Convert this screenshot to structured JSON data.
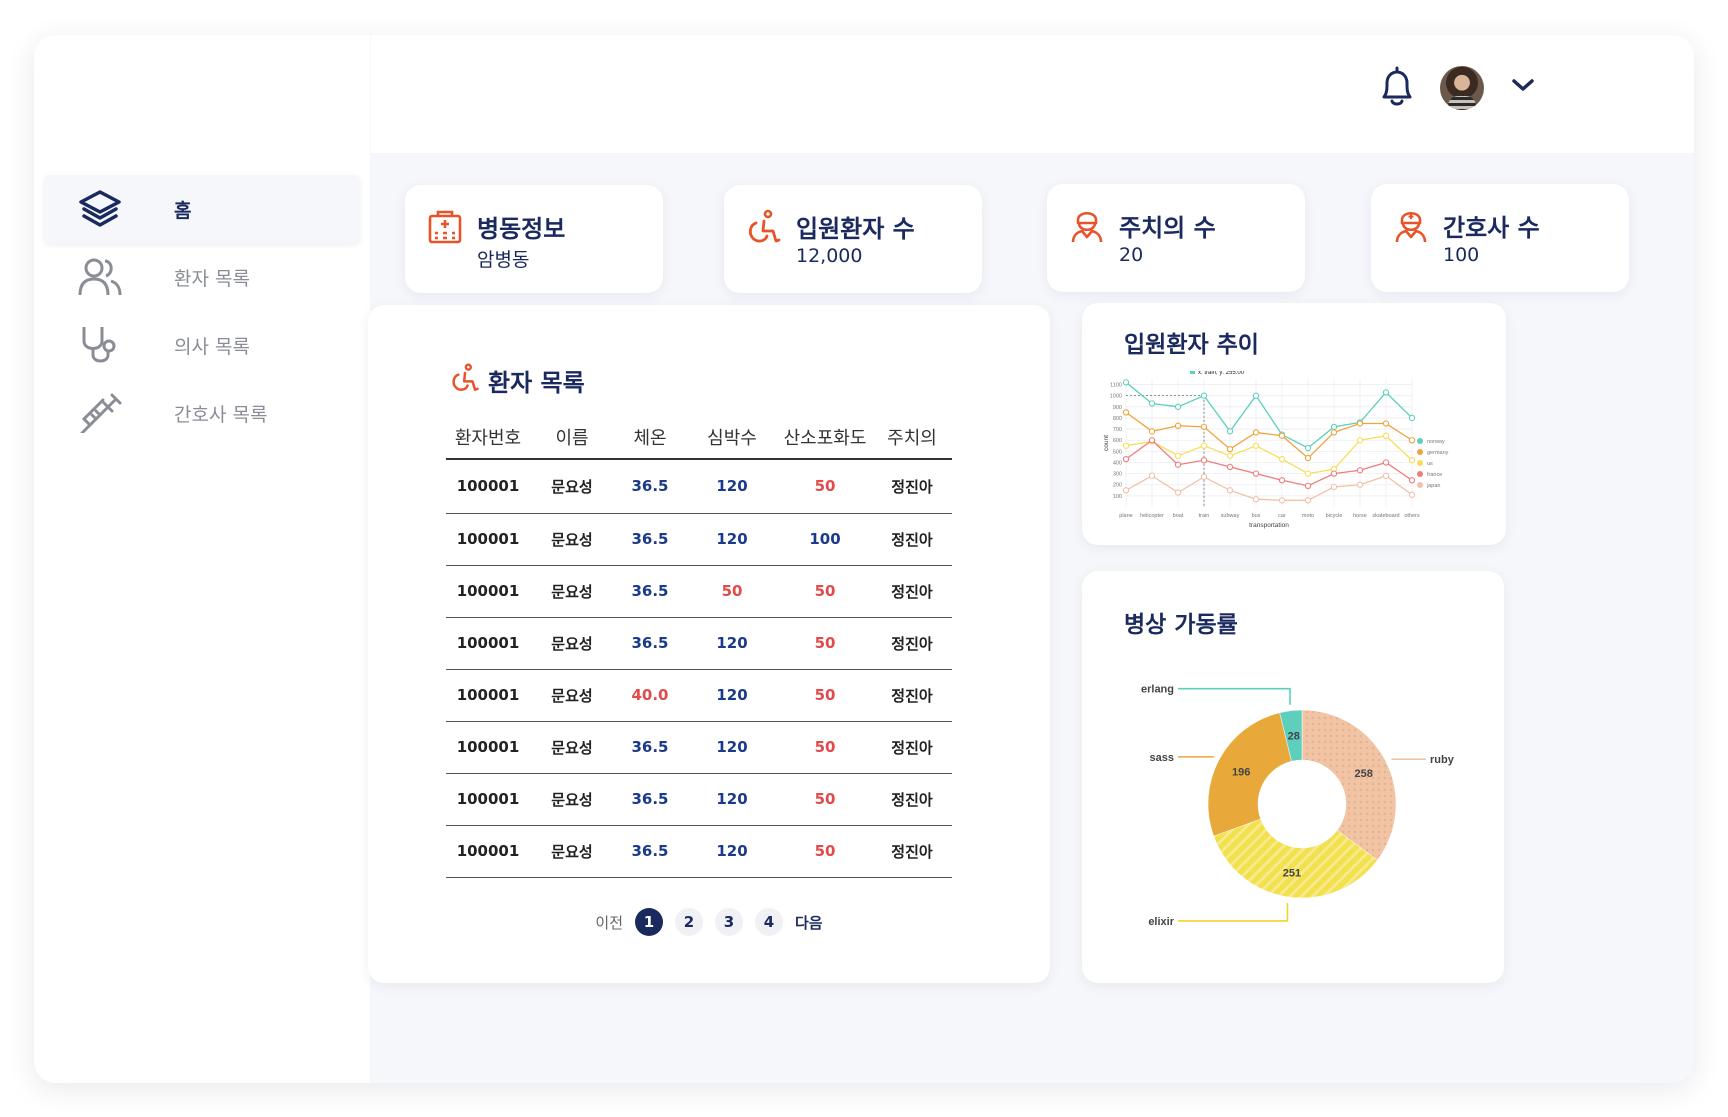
{
  "sidebar": {
    "items": [
      {
        "label": "홈",
        "icon": "layers-icon",
        "active": true
      },
      {
        "label": "환자 목록",
        "icon": "users-icon",
        "active": false
      },
      {
        "label": "의사 목록",
        "icon": "stethoscope-icon",
        "active": false
      },
      {
        "label": "간호사 목록",
        "icon": "syringe-icon",
        "active": false
      }
    ]
  },
  "header": {
    "icons": [
      "bell-icon",
      "avatar",
      "chevron-down-icon"
    ]
  },
  "stats": [
    {
      "title": "병동정보",
      "value": "암병동",
      "icon": "hospital-icon"
    },
    {
      "title": "입원환자 수",
      "value": "12,000",
      "icon": "wheelchair-icon"
    },
    {
      "title": "주치의 수",
      "value": "20",
      "icon": "doctor-icon"
    },
    {
      "title": "간호사 수",
      "value": "100",
      "icon": "nurse-icon"
    }
  ],
  "colors": {
    "navy": "#1b2a5e",
    "accent": "#e8542a",
    "red": "#e24b4b",
    "blue": "#1b3a8a"
  },
  "patients": {
    "title": "환자 목록",
    "columns": [
      "환자번호",
      "이름",
      "체온",
      "심박수",
      "산소포화도",
      "주치의"
    ],
    "rows": [
      {
        "id": "100001",
        "name": "문요성",
        "temp": "36.5",
        "hr": "120",
        "spo2": "50",
        "doctor": "정진아",
        "temp_alert": false,
        "hr_alert": false,
        "spo2_alert": true
      },
      {
        "id": "100001",
        "name": "문요성",
        "temp": "36.5",
        "hr": "120",
        "spo2": "100",
        "doctor": "정진아",
        "temp_alert": false,
        "hr_alert": false,
        "spo2_alert": false
      },
      {
        "id": "100001",
        "name": "문요성",
        "temp": "36.5",
        "hr": "50",
        "spo2": "50",
        "doctor": "정진아",
        "temp_alert": false,
        "hr_alert": true,
        "spo2_alert": true
      },
      {
        "id": "100001",
        "name": "문요성",
        "temp": "36.5",
        "hr": "120",
        "spo2": "50",
        "doctor": "정진아",
        "temp_alert": false,
        "hr_alert": false,
        "spo2_alert": true
      },
      {
        "id": "100001",
        "name": "문요성",
        "temp": "40.0",
        "hr": "120",
        "spo2": "50",
        "doctor": "정진아",
        "temp_alert": true,
        "hr_alert": false,
        "spo2_alert": true
      },
      {
        "id": "100001",
        "name": "문요성",
        "temp": "36.5",
        "hr": "120",
        "spo2": "50",
        "doctor": "정진아",
        "temp_alert": false,
        "hr_alert": false,
        "spo2_alert": true
      },
      {
        "id": "100001",
        "name": "문요성",
        "temp": "36.5",
        "hr": "120",
        "spo2": "50",
        "doctor": "정진아",
        "temp_alert": false,
        "hr_alert": false,
        "spo2_alert": true
      },
      {
        "id": "100001",
        "name": "문요성",
        "temp": "36.5",
        "hr": "120",
        "spo2": "50",
        "doctor": "정진아",
        "temp_alert": false,
        "hr_alert": false,
        "spo2_alert": true
      }
    ],
    "pagination": {
      "prev": "이전",
      "next": "다음",
      "pages": [
        "1",
        "2",
        "3",
        "4"
      ],
      "current": "1"
    }
  },
  "line_chart": {
    "title": "입원환자 추이",
    "tooltip": "x: train, y: 255.00"
  },
  "donut_chart": {
    "title": "병상 가동률"
  },
  "chart_data": [
    {
      "type": "line",
      "xlabel": "transportation",
      "ylabel": "count",
      "categories": [
        "plane",
        "helicopter",
        "boat",
        "train",
        "subway",
        "bus",
        "car",
        "moto",
        "bicycle",
        "horse",
        "skateboard",
        "others"
      ],
      "yticks": [
        100,
        200,
        300,
        400,
        500,
        600,
        700,
        800,
        900,
        1000,
        1100
      ],
      "ylim": [
        0,
        1150
      ],
      "legend": "right",
      "grid": true,
      "series": [
        {
          "name": "norway",
          "color": "#5ecfbd",
          "values": [
            1120,
            930,
            900,
            1000,
            680,
            1000,
            650,
            530,
            720,
            760,
            1030,
            800
          ]
        },
        {
          "name": "germany",
          "color": "#f0a33a",
          "values": [
            850,
            680,
            730,
            720,
            520,
            670,
            640,
            440,
            670,
            750,
            750,
            600
          ]
        },
        {
          "name": "us",
          "color": "#f7de55",
          "values": [
            550,
            590,
            460,
            550,
            460,
            550,
            430,
            300,
            340,
            600,
            640,
            420
          ]
        },
        {
          "name": "france",
          "color": "#f07c7c",
          "values": [
            430,
            600,
            380,
            420,
            360,
            300,
            240,
            190,
            300,
            330,
            400,
            240
          ]
        },
        {
          "name": "japan",
          "color": "#f2c0a8",
          "values": [
            150,
            280,
            130,
            270,
            150,
            70,
            60,
            60,
            180,
            200,
            280,
            110
          ]
        }
      ]
    },
    {
      "type": "pie",
      "labels": [
        "ruby",
        "elixir",
        "sass",
        "erlang"
      ],
      "values": [
        258,
        251,
        196,
        28
      ],
      "colors": [
        "#f0c4a4",
        "#f2e04c",
        "#e8a93a",
        "#5ecfbd"
      ]
    }
  ]
}
